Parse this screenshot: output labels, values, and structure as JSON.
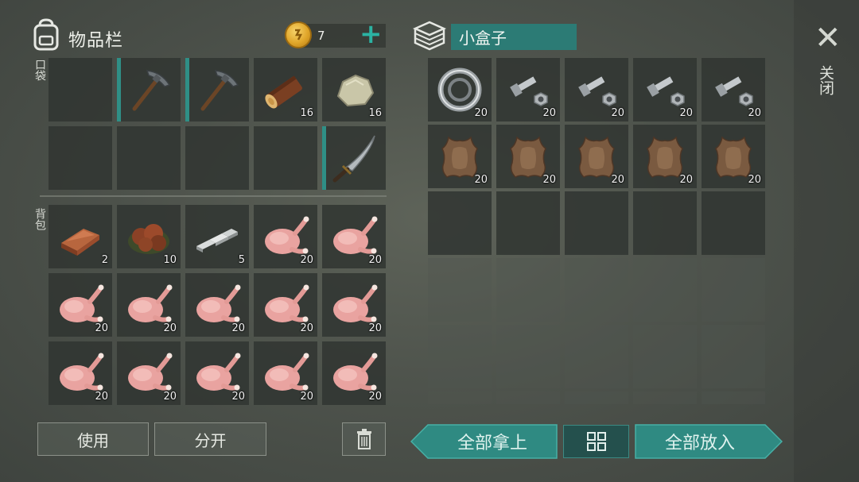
{
  "inventory": {
    "title": "物品栏",
    "pocket_label": "口袋",
    "backpack_label": "背包",
    "coins": "7",
    "pocket_slots": [
      {
        "item": "",
        "count": ""
      },
      {
        "item": "pickaxe",
        "count": "",
        "durability": 1.0
      },
      {
        "item": "pickaxe",
        "count": "",
        "durability": 1.0
      },
      {
        "item": "log",
        "count": "16"
      },
      {
        "item": "stone",
        "count": "16"
      },
      {
        "item": "",
        "count": ""
      },
      {
        "item": "",
        "count": ""
      },
      {
        "item": "",
        "count": ""
      },
      {
        "item": "",
        "count": ""
      },
      {
        "item": "machete",
        "count": "",
        "durability": 1.0
      }
    ],
    "backpack_slots": [
      {
        "item": "copper-ingot",
        "count": "2"
      },
      {
        "item": "ore-pile",
        "count": "10"
      },
      {
        "item": "iron-bars",
        "count": "5"
      },
      {
        "item": "raw-chicken",
        "count": "20"
      },
      {
        "item": "raw-chicken",
        "count": "20"
      },
      {
        "item": "raw-chicken",
        "count": "20"
      },
      {
        "item": "raw-chicken",
        "count": "20"
      },
      {
        "item": "raw-chicken",
        "count": "20"
      },
      {
        "item": "raw-chicken",
        "count": "20"
      },
      {
        "item": "raw-chicken",
        "count": "20"
      },
      {
        "item": "raw-chicken",
        "count": "20"
      },
      {
        "item": "raw-chicken",
        "count": "20"
      },
      {
        "item": "raw-chicken",
        "count": "20"
      },
      {
        "item": "raw-chicken",
        "count": "20"
      },
      {
        "item": "raw-chicken",
        "count": "20"
      }
    ],
    "use_label": "使用",
    "split_label": "分开"
  },
  "box": {
    "title": "小盒子",
    "slots": [
      {
        "item": "bearing",
        "count": "20"
      },
      {
        "item": "bolt-nut",
        "count": "20"
      },
      {
        "item": "bolt-nut",
        "count": "20"
      },
      {
        "item": "bolt-nut",
        "count": "20"
      },
      {
        "item": "bolt-nut",
        "count": "20"
      },
      {
        "item": "leather-hide",
        "count": "20"
      },
      {
        "item": "leather-hide",
        "count": "20"
      },
      {
        "item": "leather-hide",
        "count": "20"
      },
      {
        "item": "leather-hide",
        "count": "20"
      },
      {
        "item": "leather-hide",
        "count": "20"
      }
    ],
    "take_all_label": "全部拿上",
    "put_all_label": "全部放入"
  },
  "close_label": "关闭",
  "colors": {
    "accent": "#2f8a82",
    "plus": "#2bb3a3"
  }
}
